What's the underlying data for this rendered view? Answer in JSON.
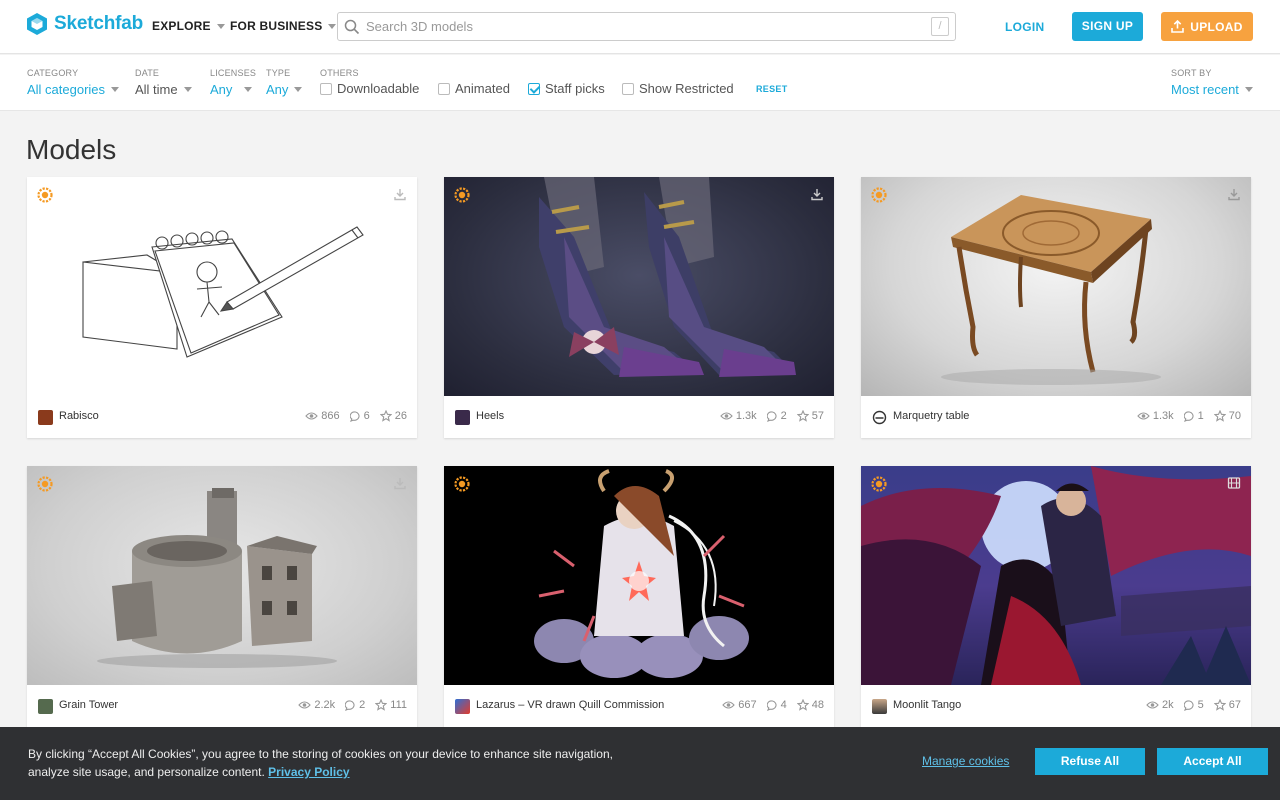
{
  "header": {
    "logo_text": "Sketchfab",
    "nav": [
      {
        "label": "EXPLORE"
      },
      {
        "label": "FOR BUSINESS"
      }
    ],
    "search_placeholder": "Search 3D models",
    "search_shortcut": "/",
    "login": "LOGIN",
    "signup": "SIGN UP",
    "upload": "UPLOAD"
  },
  "filters": {
    "category": {
      "label": "CATEGORY",
      "value": "All categories"
    },
    "date": {
      "label": "DATE",
      "value": "All time"
    },
    "licenses": {
      "label": "LICENSES",
      "value": "Any"
    },
    "type": {
      "label": "TYPE",
      "value": "Any"
    },
    "others_label": "OTHERS",
    "checkboxes": [
      {
        "label": "Downloadable",
        "checked": false
      },
      {
        "label": "Animated",
        "checked": false
      },
      {
        "label": "Staff picks",
        "checked": true
      },
      {
        "label": "Show Restricted",
        "checked": false
      }
    ],
    "reset": "RESET",
    "sort": {
      "label": "SORT BY",
      "value": "Most recent"
    }
  },
  "page_title": "Models",
  "models": [
    {
      "name": "Rabisco",
      "views": "866",
      "comments": "6",
      "likes": "26",
      "action_icon": "download-icon"
    },
    {
      "name": "Heels",
      "views": "1.3k",
      "comments": "2",
      "likes": "57",
      "action_icon": "download-icon"
    },
    {
      "name": "Marquetry table",
      "views": "1.3k",
      "comments": "1",
      "likes": "70",
      "action_icon": "download-icon"
    },
    {
      "name": "Grain Tower",
      "views": "2.2k",
      "comments": "2",
      "likes": "111",
      "action_icon": "download-icon"
    },
    {
      "name": "Lazarus – VR drawn Quill Commission",
      "views": "667",
      "comments": "4",
      "likes": "48",
      "action_icon": ""
    },
    {
      "name": "Moonlit Tango",
      "views": "2k",
      "comments": "5",
      "likes": "67",
      "action_icon": "film-icon"
    }
  ],
  "cookie": {
    "text": "By clicking “Accept All Cookies”, you agree to the storing of cookies on your device to enhance site navigation, analyze site usage, and personalize content.",
    "privacy_link": "Privacy Policy",
    "manage": "Manage cookies",
    "refuse": "Refuse All",
    "accept": "Accept All"
  },
  "colors": {
    "brand": "#1caad9",
    "upload": "#f7a23f",
    "staff_badge": "#f59a23",
    "cookie_bg": "#2f3033"
  }
}
